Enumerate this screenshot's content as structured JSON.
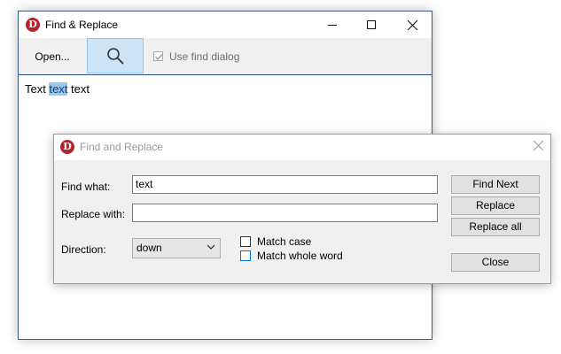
{
  "main_window": {
    "title": "Find & Replace",
    "logo_letter": "D",
    "toolbar": {
      "open_label": "Open...",
      "search_icon": "search-icon",
      "use_find_dialog_label": "Use find dialog",
      "use_find_dialog_checked": true
    },
    "content": {
      "before": "Text ",
      "selected": "text",
      "after": " text"
    }
  },
  "dialog": {
    "title": "Find and Replace",
    "logo_letter": "D",
    "find_label": "Find what:",
    "find_value": "text",
    "replace_label": "Replace with:",
    "replace_value": "",
    "direction_label": "Direction:",
    "direction_value": "down",
    "match_case_label": "Match case",
    "match_case_checked": false,
    "match_whole_word_label": "Match whole word",
    "match_whole_word_checked": false,
    "buttons": {
      "find_next": "Find Next",
      "replace": "Replace",
      "replace_all": "Replace all",
      "close": "Close"
    }
  },
  "colors": {
    "logo": "#b5232a",
    "selection": "#99c9ef",
    "active_toolbar_button": "#cce4f7",
    "focus_border": "#0078d7"
  }
}
